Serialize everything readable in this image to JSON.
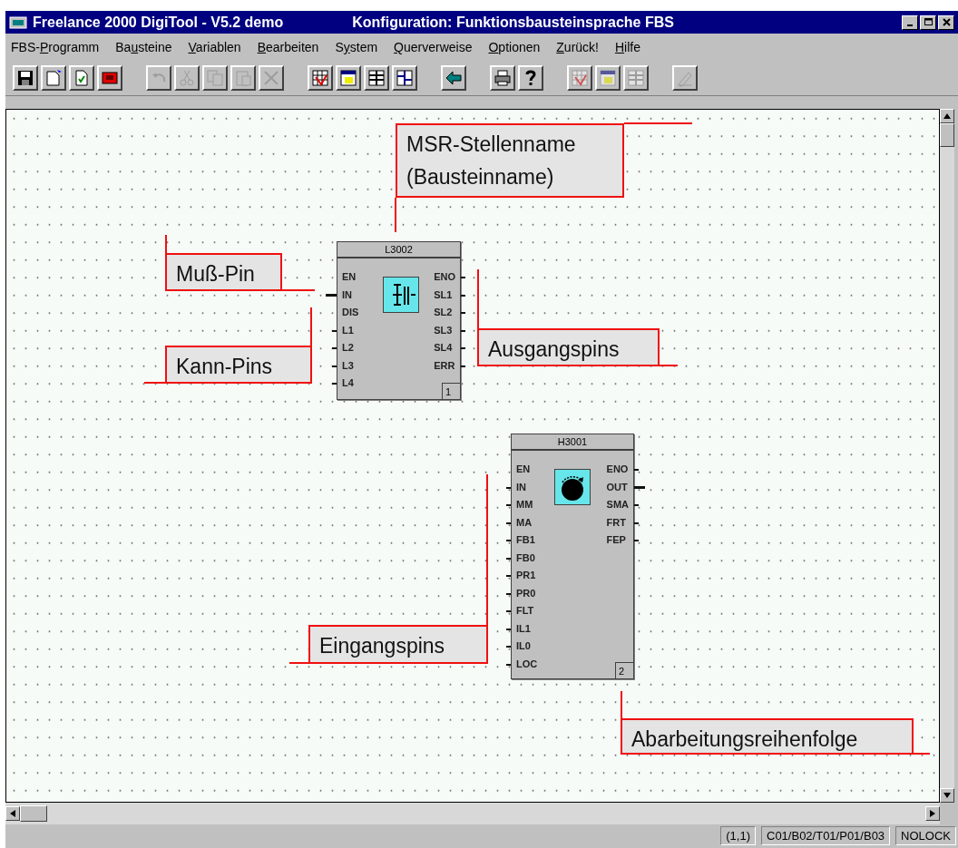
{
  "window": {
    "title": "Freelance 2000 DigiTool - V5.2 demo",
    "subtitle": "Konfiguration: Funktionsbausteinsprache FBS"
  },
  "menu": [
    {
      "pre": "FBS-",
      "key": "P",
      "post": "rogramm"
    },
    {
      "pre": "Ba",
      "key": "u",
      "post": "steine"
    },
    {
      "key": "V",
      "post": "ariablen"
    },
    {
      "key": "B",
      "post": "earbeiten"
    },
    {
      "pre": "S",
      "key": "y",
      "post": "stem"
    },
    {
      "key": "Q",
      "post": "uerverweise"
    },
    {
      "key": "O",
      "post": "ptionen"
    },
    {
      "key": "Z",
      "post": "urück!"
    },
    {
      "key": "H",
      "post": "ilfe"
    }
  ],
  "toolbar": [
    [
      {
        "kind": "save",
        "disabled": false
      },
      {
        "kind": "new",
        "disabled": false
      },
      {
        "kind": "check",
        "disabled": false
      },
      {
        "kind": "red",
        "disabled": false
      }
    ],
    [
      {
        "kind": "undo",
        "disabled": true
      },
      {
        "kind": "cut",
        "disabled": true
      },
      {
        "kind": "copy",
        "disabled": true
      },
      {
        "kind": "paste",
        "disabled": true
      },
      {
        "kind": "delete",
        "disabled": true
      }
    ],
    [
      {
        "kind": "grid",
        "disabled": false
      },
      {
        "kind": "panel",
        "disabled": false
      },
      {
        "kind": "table",
        "disabled": false
      },
      {
        "kind": "columns",
        "disabled": false
      }
    ],
    [
      {
        "kind": "back",
        "disabled": false
      }
    ],
    [
      {
        "kind": "print",
        "disabled": false
      },
      {
        "kind": "help",
        "disabled": false
      }
    ],
    [
      {
        "kind": "grid",
        "disabled": true
      },
      {
        "kind": "panel",
        "disabled": true
      },
      {
        "kind": "table",
        "disabled": true
      }
    ],
    [
      {
        "kind": "pen",
        "disabled": true
      }
    ]
  ],
  "blocks": [
    {
      "name": "L3002",
      "number": "1",
      "inputs": [
        {
          "label": "EN",
          "kind": "none"
        },
        {
          "label": "IN",
          "kind": "must"
        },
        {
          "label": "DIS",
          "kind": "none"
        },
        {
          "label": "L1",
          "kind": "can"
        },
        {
          "label": "L2",
          "kind": "can"
        },
        {
          "label": "L3",
          "kind": "can"
        },
        {
          "label": "L4",
          "kind": "can"
        }
      ],
      "outputs": [
        {
          "label": "ENO",
          "kind": "can"
        },
        {
          "label": "SL1",
          "kind": "can"
        },
        {
          "label": "SL2",
          "kind": "can"
        },
        {
          "label": "SL3",
          "kind": "can"
        },
        {
          "label": "SL4",
          "kind": "can"
        },
        {
          "label": "ERR",
          "kind": "can"
        }
      ]
    },
    {
      "name": "H3001",
      "number": "2",
      "inputs": [
        {
          "label": "EN",
          "kind": "none"
        },
        {
          "label": "IN",
          "kind": "can"
        },
        {
          "label": "MM",
          "kind": "can"
        },
        {
          "label": "MA",
          "kind": "can"
        },
        {
          "label": "FB1",
          "kind": "can"
        },
        {
          "label": "FB0",
          "kind": "can"
        },
        {
          "label": "PR1",
          "kind": "can"
        },
        {
          "label": "PR0",
          "kind": "can"
        },
        {
          "label": "FLT",
          "kind": "can"
        },
        {
          "label": "IL1",
          "kind": "can"
        },
        {
          "label": "IL0",
          "kind": "can"
        },
        {
          "label": "LOC",
          "kind": "can"
        }
      ],
      "outputs": [
        {
          "label": "ENO",
          "kind": "can"
        },
        {
          "label": "OUT",
          "kind": "must"
        },
        {
          "label": "SMA",
          "kind": "can"
        },
        {
          "label": "FRT",
          "kind": "can"
        },
        {
          "label": "FEP",
          "kind": "can"
        }
      ]
    }
  ],
  "callouts": [
    {
      "text": "MSR-Stellenname (Bausteinname)"
    },
    {
      "text": "Muß-Pin"
    },
    {
      "text": "Kann-Pins"
    },
    {
      "text": "Ausgangspins"
    },
    {
      "text": "Eingangspins"
    },
    {
      "text": "Abarbeitungsreihenfolge"
    }
  ],
  "status_bar": [
    "(1,1)",
    "C01/B02/T01/P01/B03",
    "NOLOCK"
  ]
}
